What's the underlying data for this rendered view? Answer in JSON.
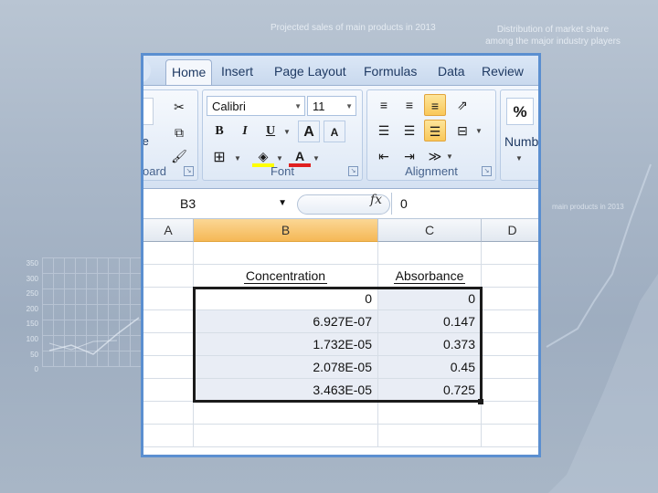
{
  "background": {
    "title_left": "Projected sales of main products in 2013",
    "title_right": "Distribution of market share among the major industry players",
    "right_caption": "main products in 2013",
    "axis_ticks": [
      "350",
      "300",
      "250",
      "200",
      "150",
      "100",
      "50",
      "0"
    ]
  },
  "ribbon": {
    "tabs": [
      "Home",
      "Insert",
      "Page Layout",
      "Formulas",
      "Data",
      "Review"
    ],
    "active_tab": "Home",
    "clipboard": {
      "paste_label_partial": "te",
      "group_label": "oard"
    },
    "font": {
      "name": "Calibri",
      "size": "11",
      "group_label": "Font",
      "bold": "B",
      "italic": "I",
      "underline": "U",
      "grow": "A",
      "shrink": "A",
      "color": "A"
    },
    "alignment": {
      "group_label": "Alignment"
    },
    "number": {
      "percent": "%",
      "label_partial": "Numb"
    }
  },
  "formula_bar": {
    "name_box": "B3",
    "fx": "fx",
    "value": "0"
  },
  "sheet": {
    "columns": [
      "A",
      "B",
      "C",
      "D"
    ],
    "selected_column": "B",
    "headers": [
      "Concentration",
      "Absorbance"
    ],
    "rows": [
      [
        "0",
        "0"
      ],
      [
        "6.927E-07",
        "0.147"
      ],
      [
        "1.732E-05",
        "0.373"
      ],
      [
        "2.078E-05",
        "0.45"
      ],
      [
        "3.463E-05",
        "0.725"
      ]
    ]
  },
  "colors": {
    "window_border": "#5b8fd0",
    "selected_header": "#f5b856",
    "shaded_cell": "#e9edf5"
  }
}
